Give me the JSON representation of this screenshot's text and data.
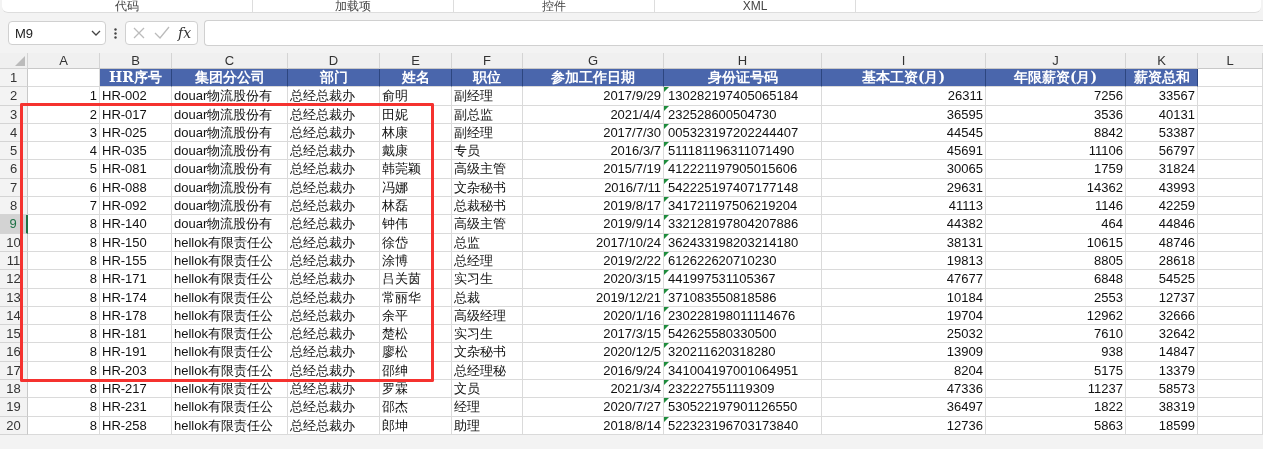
{
  "ribbon_groups": [
    "代码",
    "加载项",
    "控件",
    "XML"
  ],
  "formula_bar": {
    "name_box": "M9",
    "function_label": "fx"
  },
  "sheet": {
    "columns": [
      {
        "letter": "A",
        "kind": "number"
      },
      {
        "letter": "B",
        "kind": "text"
      },
      {
        "letter": "C",
        "kind": "text"
      },
      {
        "letter": "D",
        "kind": "text"
      },
      {
        "letter": "E",
        "kind": "text"
      },
      {
        "letter": "F",
        "kind": "text"
      },
      {
        "letter": "G",
        "kind": "number"
      },
      {
        "letter": "H",
        "kind": "flagged_text"
      },
      {
        "letter": "I",
        "kind": "number"
      },
      {
        "letter": "J",
        "kind": "number"
      },
      {
        "letter": "K",
        "kind": "number"
      },
      {
        "letter": "L",
        "kind": "text"
      }
    ],
    "rows": [
      {
        "number": "1",
        "kind": "header",
        "selected": false,
        "outlined": false,
        "cells": [
          null,
          "HR序号",
          "集团分公司",
          "部门",
          "姓名",
          "职位",
          "参加工作日期",
          "身份证号码",
          "基本工资(月)",
          "年限薪资(月)",
          "薪资总和"
        ]
      },
      {
        "number": "2",
        "kind": "data",
        "selected": false,
        "outlined": false,
        "cells": [
          "1",
          "HR-002",
          "douar物流股份有",
          "总经总裁办",
          "俞明",
          "副经理",
          "2017/9/29",
          "130282197405065184",
          "26311",
          "7256",
          "33567"
        ]
      },
      {
        "number": "3",
        "kind": "data",
        "selected": false,
        "outlined": true,
        "cells": [
          "2",
          "HR-017",
          "douar物流股份有",
          "总经总裁办",
          "田妮",
          "副总监",
          "2021/4/4",
          "232528600504730",
          "36595",
          "3536",
          "40131"
        ]
      },
      {
        "number": "4",
        "kind": "data",
        "selected": false,
        "outlined": true,
        "cells": [
          "3",
          "HR-025",
          "douar物流股份有",
          "总经总裁办",
          "林康",
          "副经理",
          "2017/7/30",
          "005323197202244407",
          "44545",
          "8842",
          "53387"
        ]
      },
      {
        "number": "5",
        "kind": "data",
        "selected": false,
        "outlined": true,
        "cells": [
          "4",
          "HR-035",
          "douar物流股份有",
          "总经总裁办",
          "戴康",
          "专员",
          "2016/3/7",
          "511181196311071490",
          "45691",
          "11106",
          "56797"
        ]
      },
      {
        "number": "6",
        "kind": "data",
        "selected": false,
        "outlined": true,
        "cells": [
          "5",
          "HR-081",
          "douar物流股份有",
          "总经总裁办",
          "韩莞颖",
          "高级主管",
          "2015/7/19",
          "412221197905015606",
          "30065",
          "1759",
          "31824"
        ]
      },
      {
        "number": "7",
        "kind": "data",
        "selected": false,
        "outlined": true,
        "cells": [
          "6",
          "HR-088",
          "douar物流股份有",
          "总经总裁办",
          "冯娜",
          "文杂秘书",
          "2016/7/11",
          "542225197407177148",
          "29631",
          "14362",
          "43993"
        ]
      },
      {
        "number": "8",
        "kind": "data",
        "selected": false,
        "outlined": true,
        "cells": [
          "7",
          "HR-092",
          "douar物流股份有",
          "总经总裁办",
          "林磊",
          "总裁秘书",
          "2019/8/17",
          "341721197506219204",
          "41113",
          "1146",
          "42259"
        ]
      },
      {
        "number": "9",
        "kind": "data",
        "selected": true,
        "outlined": true,
        "cells": [
          "8",
          "HR-140",
          "douar物流股份有",
          "总经总裁办",
          "钟伟",
          "高级主管",
          "2019/9/14",
          "332128197804207886",
          "44382",
          "464",
          "44846"
        ]
      },
      {
        "number": "10",
        "kind": "data",
        "selected": false,
        "outlined": true,
        "cells": [
          "8",
          "HR-150",
          "hellok有限责任公",
          "总经总裁办",
          "徐岱",
          "总监",
          "2017/10/24",
          "362433198203214180",
          "38131",
          "10615",
          "48746"
        ]
      },
      {
        "number": "11",
        "kind": "data",
        "selected": false,
        "outlined": true,
        "cells": [
          "8",
          "HR-155",
          "hellok有限责任公",
          "总经总裁办",
          "涂博",
          "总经理",
          "2019/2/22",
          "612622620710230",
          "19813",
          "8805",
          "28618"
        ]
      },
      {
        "number": "12",
        "kind": "data",
        "selected": false,
        "outlined": true,
        "cells": [
          "8",
          "HR-171",
          "hellok有限责任公",
          "总经总裁办",
          "吕关茵",
          "实习生",
          "2020/3/15",
          "441997531105367",
          "47677",
          "6848",
          "54525"
        ]
      },
      {
        "number": "13",
        "kind": "data",
        "selected": false,
        "outlined": true,
        "cells": [
          "8",
          "HR-174",
          "hellok有限责任公",
          "总经总裁办",
          "常丽华",
          "总裁",
          "2019/12/21",
          "371083550818586",
          "10184",
          "2553",
          "12737"
        ]
      },
      {
        "number": "14",
        "kind": "data",
        "selected": false,
        "outlined": true,
        "cells": [
          "8",
          "HR-178",
          "hellok有限责任公",
          "总经总裁办",
          "余平",
          "高级经理",
          "2020/1/16",
          "230228198011114676",
          "19704",
          "12962",
          "32666"
        ]
      },
      {
        "number": "15",
        "kind": "data",
        "selected": false,
        "outlined": true,
        "cells": [
          "8",
          "HR-181",
          "hellok有限责任公",
          "总经总裁办",
          "楚松",
          "实习生",
          "2017/3/15",
          "542625580330500",
          "25032",
          "7610",
          "32642"
        ]
      },
      {
        "number": "16",
        "kind": "data",
        "selected": false,
        "outlined": true,
        "cells": [
          "8",
          "HR-191",
          "hellok有限责任公",
          "总经总裁办",
          "廖松",
          "文杂秘书",
          "2020/12/5",
          "320211620318280",
          "13909",
          "938",
          "14847"
        ]
      },
      {
        "number": "17",
        "kind": "data",
        "selected": false,
        "outlined": true,
        "cells": [
          "8",
          "HR-203",
          "hellok有限责任公",
          "总经总裁办",
          "邵绅",
          "总经理秘",
          "2016/9/24",
          "341004197001064951",
          "8204",
          "5175",
          "13379"
        ]
      },
      {
        "number": "18",
        "kind": "data",
        "selected": false,
        "outlined": false,
        "cells": [
          "8",
          "HR-217",
          "hellok有限责任公",
          "总经总裁办",
          "罗霖",
          "文员",
          "2021/3/4",
          "232227551119309",
          "47336",
          "11237",
          "58573"
        ]
      },
      {
        "number": "19",
        "kind": "data",
        "selected": false,
        "outlined": false,
        "cells": [
          "8",
          "HR-231",
          "hellok有限责任公",
          "总经总裁办",
          "邵杰",
          "经理",
          "2020/7/27",
          "530522197901126550",
          "36497",
          "1822",
          "38319"
        ]
      },
      {
        "number": "20",
        "kind": "data",
        "selected": false,
        "outlined": false,
        "cells": [
          "8",
          "HR-258",
          "hellok有限责任公",
          "总经总裁办",
          "郎坤",
          "助理",
          "2018/8/14",
          "522323196703173840",
          "12736",
          "5863",
          "18599"
        ]
      }
    ]
  }
}
